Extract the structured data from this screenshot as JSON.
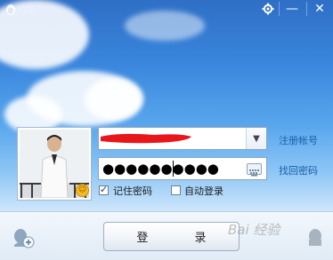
{
  "window": {
    "title": "QQ"
  },
  "titlebar": {
    "settings_icon": "gear-icon",
    "minimize_label": "—",
    "close_label": "✕"
  },
  "account": {
    "value_redacted": true,
    "dropdown_icon": "chevron-down-icon"
  },
  "password": {
    "masked_value": "●●●●●●●●●●",
    "keyboard_icon": "keyboard-icon"
  },
  "links": {
    "register": "注册帐号",
    "forgot": "找回密码"
  },
  "options": {
    "remember_password": "记住密码",
    "remember_checked": true,
    "auto_login": "自动登录",
    "auto_checked": false
  },
  "login_button": "登 录",
  "watermark": "Bai 经验"
}
